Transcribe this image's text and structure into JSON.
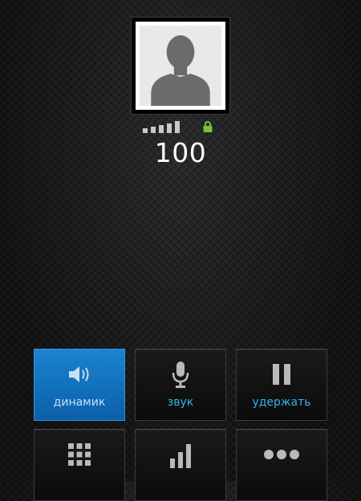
{
  "caller": {
    "number": "100"
  },
  "icons": {
    "avatar": "person-silhouette-icon",
    "signal": "signal-strength-icon",
    "lock": "lock-icon"
  },
  "colors": {
    "accent": "#33b5e5",
    "active_button": "#1176c4",
    "lock": "#7ac143",
    "icon": "#b9b9b9"
  },
  "buttons": {
    "speaker": {
      "label": "динамик",
      "icon": "speaker-icon",
      "active": true
    },
    "mute": {
      "label": "звук",
      "icon": "microphone-icon",
      "active": false
    },
    "hold": {
      "label": "удержать",
      "icon": "pause-icon",
      "active": false
    },
    "keypad": {
      "label": "",
      "icon": "dialpad-icon",
      "active": false
    },
    "add_call": {
      "label": "",
      "icon": "bars-icon",
      "active": false
    },
    "more": {
      "label": "",
      "icon": "more-icon",
      "active": false
    }
  }
}
